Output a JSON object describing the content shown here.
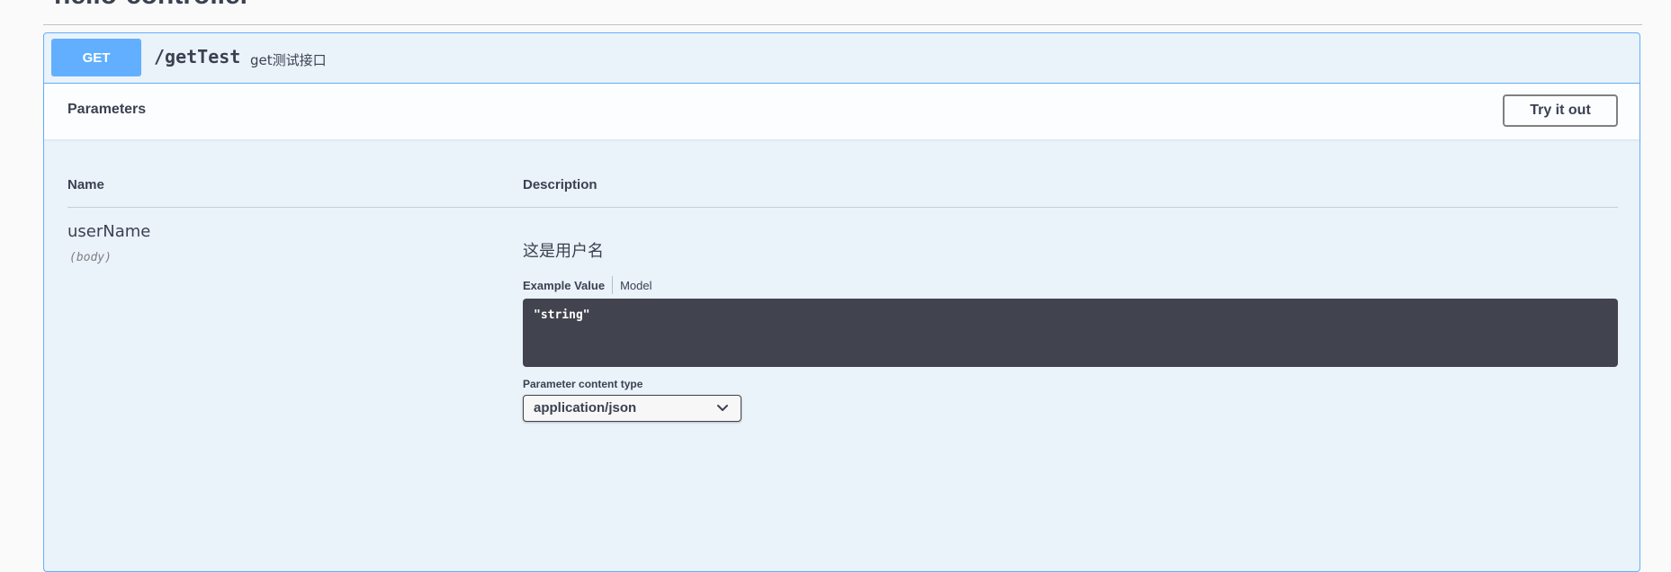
{
  "section": {
    "title": "hello-controller"
  },
  "operation": {
    "method": "GET",
    "path": "/getTest",
    "summary": "get测试接口",
    "method_color": "#61affe"
  },
  "parameters": {
    "header_title": "Parameters",
    "try_it_out_label": "Try it out",
    "columns": {
      "name": "Name",
      "description": "Description"
    },
    "items": [
      {
        "name": "userName",
        "in": "(body)",
        "description": "这是用户名",
        "tabs": {
          "example": "Example Value",
          "model": "Model"
        },
        "example_value": "\"string\"",
        "content_type_label": "Parameter content type",
        "content_type_value": "application/json",
        "chevron_icon": "chevron-down-icon"
      }
    ]
  }
}
